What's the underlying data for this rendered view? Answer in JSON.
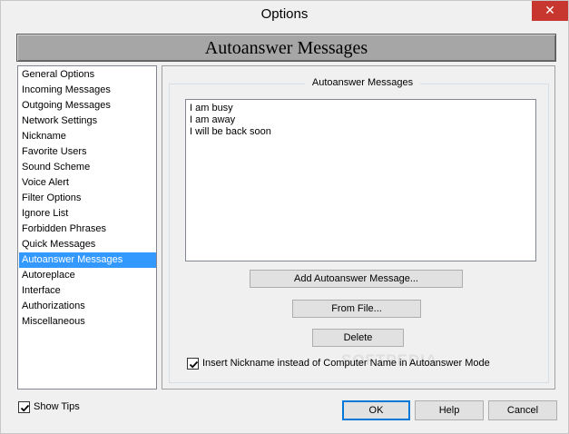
{
  "window": {
    "title": "Options",
    "close_glyph": "✕"
  },
  "banner": {
    "title": "Autoanswer Messages"
  },
  "nav": {
    "items": [
      {
        "label": "General Options",
        "selected": false
      },
      {
        "label": "Incoming Messages",
        "selected": false
      },
      {
        "label": "Outgoing Messages",
        "selected": false
      },
      {
        "label": "Network Settings",
        "selected": false
      },
      {
        "label": "Nickname",
        "selected": false
      },
      {
        "label": "Favorite Users",
        "selected": false
      },
      {
        "label": "Sound Scheme",
        "selected": false
      },
      {
        "label": "Voice Alert",
        "selected": false
      },
      {
        "label": "Filter Options",
        "selected": false
      },
      {
        "label": "Ignore List",
        "selected": false
      },
      {
        "label": "Forbidden Phrases",
        "selected": false
      },
      {
        "label": "Quick Messages",
        "selected": false
      },
      {
        "label": "Autoanswer Messages",
        "selected": true
      },
      {
        "label": "Autoreplace",
        "selected": false
      },
      {
        "label": "Interface",
        "selected": false
      },
      {
        "label": "Authorizations",
        "selected": false
      },
      {
        "label": "Miscellaneous",
        "selected": false
      }
    ]
  },
  "panel": {
    "group_title": "Autoanswer Messages",
    "messages": [
      "I am busy",
      "I am away",
      "I will be back soon"
    ],
    "add_button": "Add Autoanswer Message...",
    "from_file_button": "From File...",
    "delete_button": "Delete",
    "insert_nickname": {
      "label": "Insert Nickname instead of Computer Name in Autoanswer Mode",
      "checked": true
    }
  },
  "footer": {
    "show_tips": {
      "label": "Show Tips",
      "checked": true
    },
    "ok_button": "OK",
    "help_button": "Help",
    "cancel_button": "Cancel"
  },
  "watermark": "SOFTPEDIA",
  "colors": {
    "selection": "#3399ff",
    "close_button": "#c7372f",
    "banner": "#a6a6a6",
    "default_button_border": "#0078d7"
  }
}
